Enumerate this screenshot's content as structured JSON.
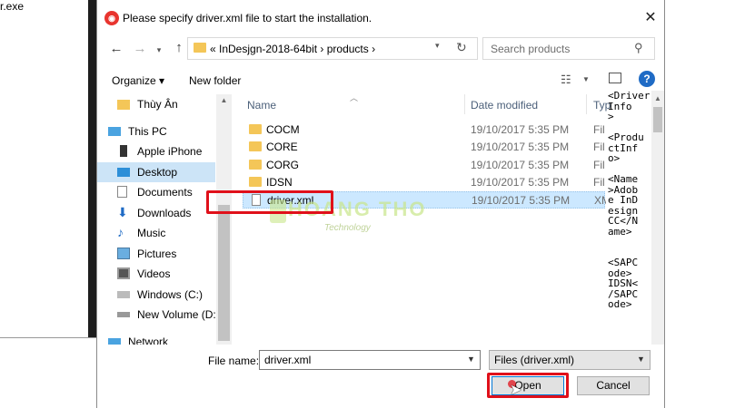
{
  "background": {
    "exe_label": "r.exe"
  },
  "dialog": {
    "title": "Please specify driver.xml file to start the installation.",
    "app_icon": "app-badge-icon",
    "close_label": "✕"
  },
  "address": {
    "path": "«  InDesjgn-2018-64bit  ›  products  ›",
    "search_placeholder": "Search products"
  },
  "toolbar": {
    "organize": "Organize ▾",
    "new_folder": "New folder"
  },
  "nav": {
    "items": [
      {
        "label": "Thùy Ân",
        "icon": "folder-icon"
      },
      {
        "label": "This PC",
        "icon": "computer-icon"
      },
      {
        "label": "Apple iPhone",
        "icon": "phone-icon"
      },
      {
        "label": "Desktop",
        "icon": "desktop-icon",
        "selected": true
      },
      {
        "label": "Documents",
        "icon": "documents-icon"
      },
      {
        "label": "Downloads",
        "icon": "downloads-icon"
      },
      {
        "label": "Music",
        "icon": "music-icon"
      },
      {
        "label": "Pictures",
        "icon": "pictures-icon"
      },
      {
        "label": "Videos",
        "icon": "videos-icon"
      },
      {
        "label": "Windows (C:)",
        "icon": "drive-icon"
      },
      {
        "label": "New Volume (D:",
        "icon": "drive-icon"
      },
      {
        "label": "Network",
        "icon": "network-icon"
      }
    ]
  },
  "files": {
    "columns": {
      "name": "Name",
      "date": "Date modified",
      "type": "Typ"
    },
    "rows": [
      {
        "name": "COCM",
        "date": "19/10/2017 5:35 PM",
        "type": "File",
        "kind": "folder"
      },
      {
        "name": "CORE",
        "date": "19/10/2017 5:35 PM",
        "type": "File",
        "kind": "folder"
      },
      {
        "name": "CORG",
        "date": "19/10/2017 5:35 PM",
        "type": "File",
        "kind": "folder"
      },
      {
        "name": "IDSN",
        "date": "19/10/2017 5:35 PM",
        "type": "File",
        "kind": "folder"
      },
      {
        "name": "driver.xml",
        "date": "19/10/2017 5:35 PM",
        "type": "XML",
        "kind": "file",
        "selected": true
      }
    ]
  },
  "watermark": {
    "title": "HOANG THO",
    "subtitle": "Technology"
  },
  "preview": {
    "text": "<Driver\nInfo\n>\n\n<Produ\nctInf\no>\n\n<Name\n>Adob\ne InD\nesign\nCC</N\name>\n\n\n<SAPC\node>\nIDSN<\n/SAPC\node>"
  },
  "bottom": {
    "filename_label": "File name:",
    "filename_value": "driver.xml",
    "filetype_value": "Files (driver.xml)",
    "open_label": "Open",
    "cancel_label": "Cancel"
  },
  "colors": {
    "accent": "#0078d7",
    "highlight": "#e0101a",
    "selection": "#cce4f7"
  }
}
